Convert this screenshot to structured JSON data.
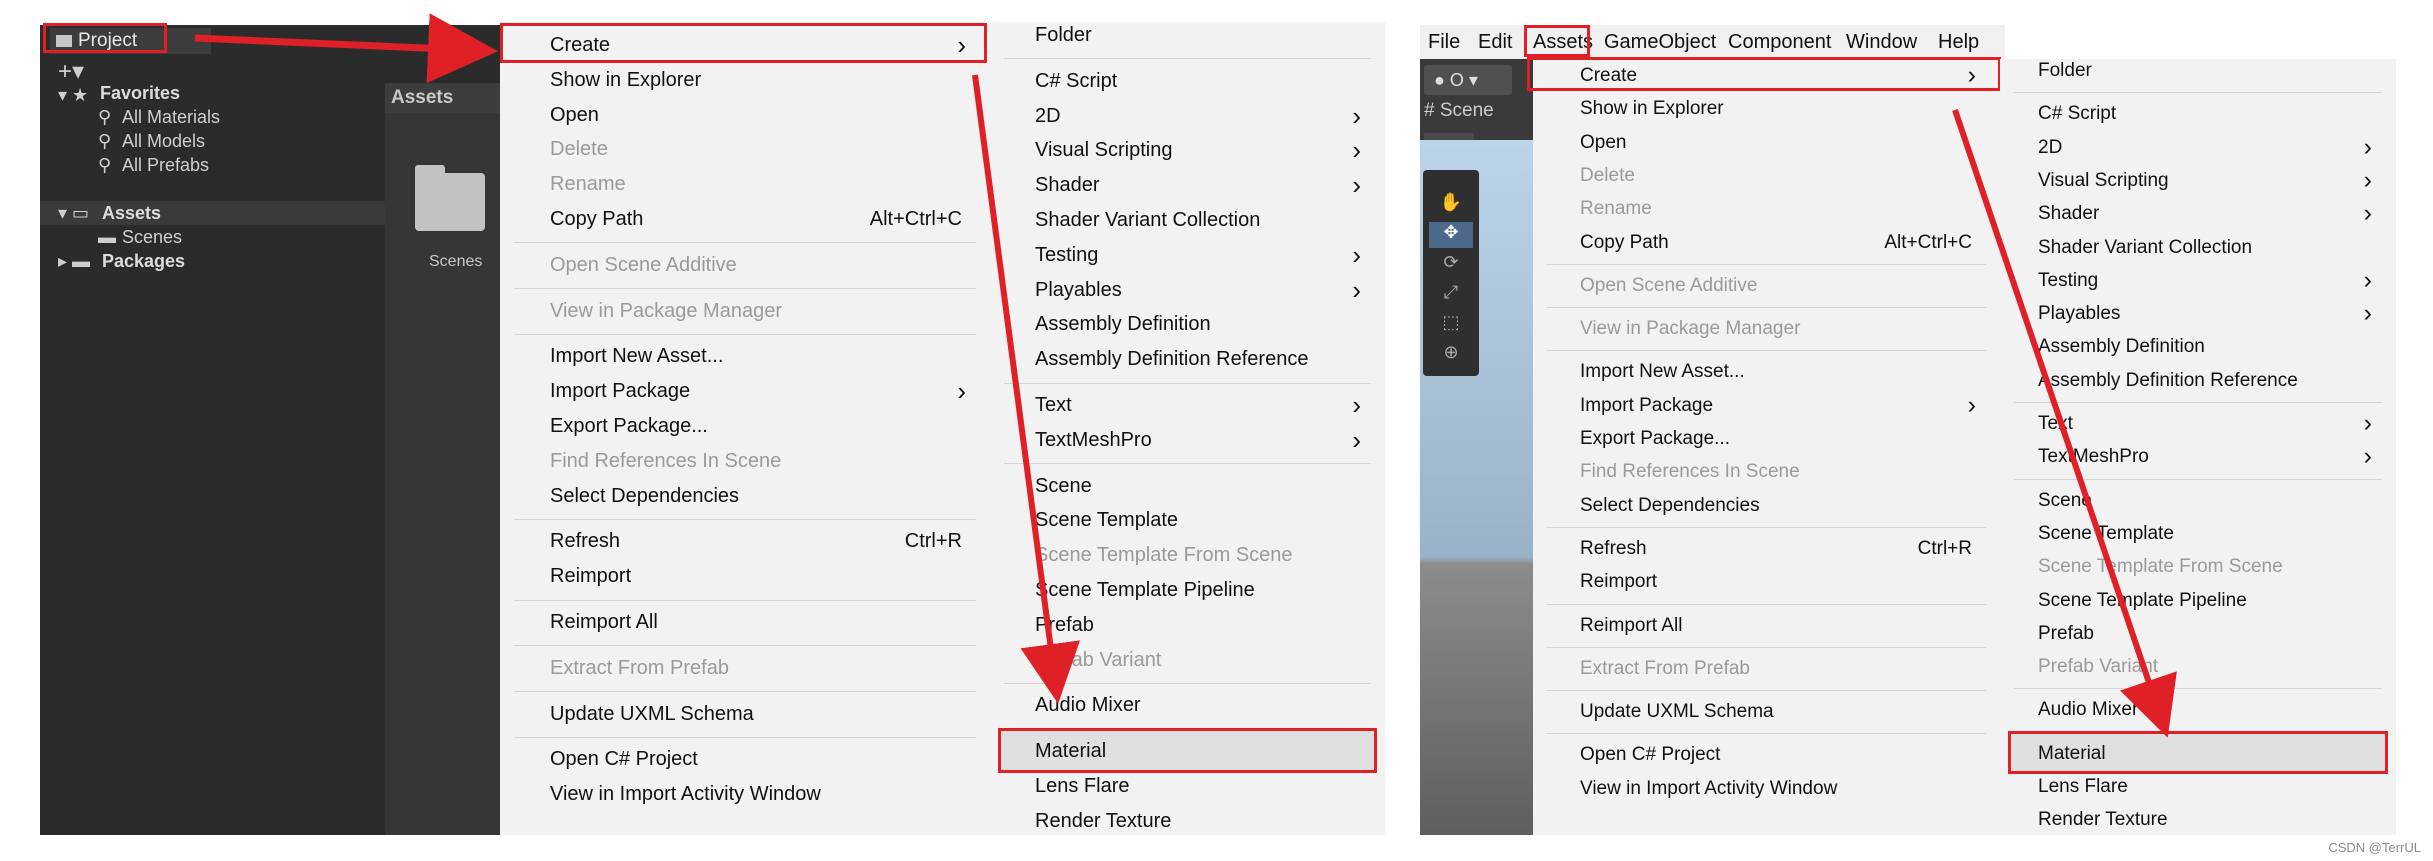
{
  "left_panel": {
    "project_tab": "Project",
    "favorites": "Favorites",
    "favorites_items": [
      "All Materials",
      "All Models",
      "All Prefabs"
    ],
    "assets": "Assets",
    "assets_children": [
      "Scenes"
    ],
    "packages": "Packages",
    "assets_header": "Assets",
    "folder_label": "Scenes"
  },
  "context_menu": [
    {
      "label": "Create",
      "arrow": true
    },
    {
      "label": "Show in Explorer"
    },
    {
      "label": "Open"
    },
    {
      "label": "Delete",
      "disabled": true
    },
    {
      "label": "Rename",
      "disabled": true
    },
    {
      "label": "Copy Path",
      "shortcut": "Alt+Ctrl+C"
    },
    {
      "separator": true
    },
    {
      "label": "Open Scene Additive",
      "disabled": true
    },
    {
      "separator": true
    },
    {
      "label": "View in Package Manager",
      "disabled": true
    },
    {
      "separator": true
    },
    {
      "label": "Import New Asset..."
    },
    {
      "label": "Import Package",
      "arrow": true
    },
    {
      "label": "Export Package..."
    },
    {
      "label": "Find References In Scene",
      "disabled": true
    },
    {
      "label": "Select Dependencies"
    },
    {
      "separator": true
    },
    {
      "label": "Refresh",
      "shortcut": "Ctrl+R"
    },
    {
      "label": "Reimport"
    },
    {
      "separator": true
    },
    {
      "label": "Reimport All"
    },
    {
      "separator": true
    },
    {
      "label": "Extract From Prefab",
      "disabled": true
    },
    {
      "separator": true
    },
    {
      "label": "Update UXML Schema"
    },
    {
      "separator": true
    },
    {
      "label": "Open C# Project"
    },
    {
      "label": "View in Import Activity Window"
    }
  ],
  "create_submenu": [
    {
      "label": "Folder"
    },
    {
      "separator": true
    },
    {
      "label": "C# Script"
    },
    {
      "label": "2D",
      "arrow": true
    },
    {
      "label": "Visual Scripting",
      "arrow": true
    },
    {
      "label": "Shader",
      "arrow": true
    },
    {
      "label": "Shader Variant Collection"
    },
    {
      "label": "Testing",
      "arrow": true
    },
    {
      "label": "Playables",
      "arrow": true
    },
    {
      "label": "Assembly Definition"
    },
    {
      "label": "Assembly Definition Reference"
    },
    {
      "separator": true
    },
    {
      "label": "Text",
      "arrow": true
    },
    {
      "label": "TextMeshPro",
      "arrow": true
    },
    {
      "separator": true
    },
    {
      "label": "Scene"
    },
    {
      "label": "Scene Template"
    },
    {
      "label": "Scene Template From Scene",
      "disabled": true
    },
    {
      "label": "Scene Template Pipeline"
    },
    {
      "label": "Prefab"
    },
    {
      "label": "Prefab Variant",
      "disabled": true
    },
    {
      "separator": true
    },
    {
      "label": "Audio Mixer"
    },
    {
      "separator": true
    },
    {
      "label": "Material",
      "highlight": true
    },
    {
      "label": "Lens Flare"
    },
    {
      "label": "Render Texture"
    }
  ],
  "menubar": [
    "File",
    "Edit",
    "Assets",
    "GameObject",
    "Component",
    "Window",
    "Help"
  ],
  "scene_tab": "Scene",
  "toolbar_value": "O",
  "watermark": "CSDN @TerrUL",
  "colors": {
    "highlight_border": "#e02027",
    "arrow": "#e02027",
    "menu_bg": "#f2f2f2",
    "dark_panel": "#2b2b2b"
  }
}
